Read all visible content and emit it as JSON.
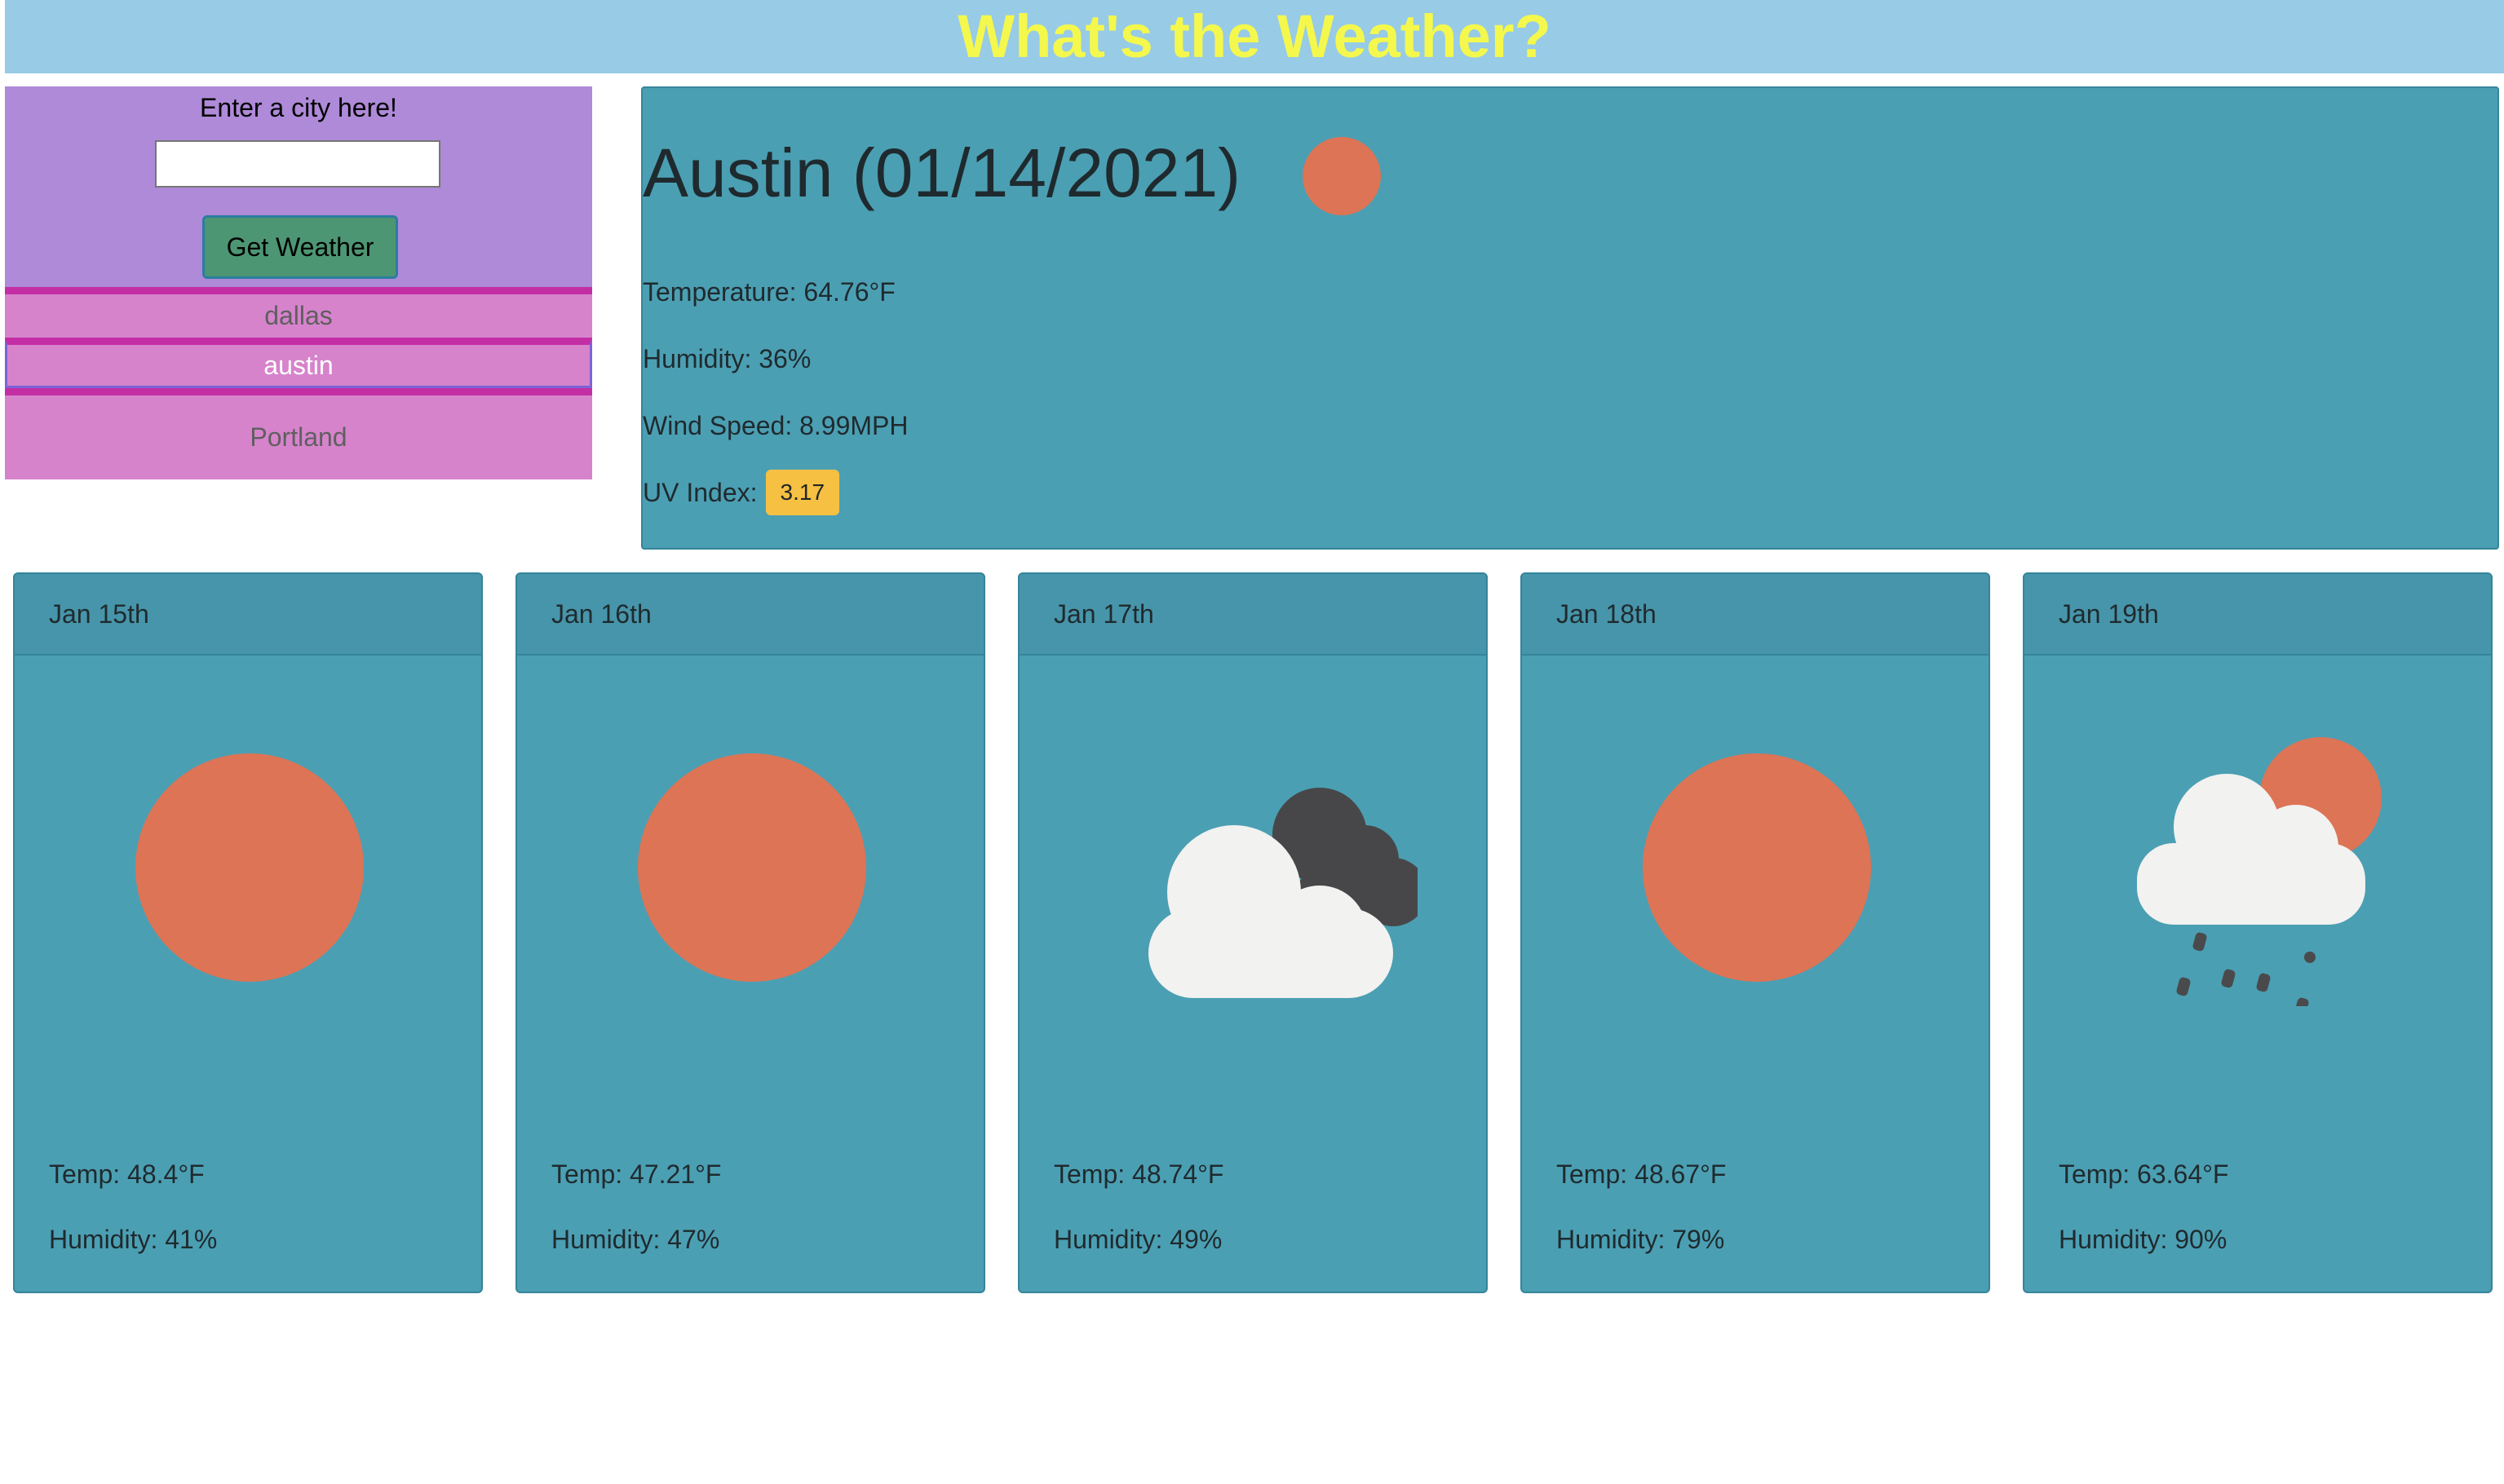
{
  "header": {
    "title": "What's the Weather?"
  },
  "search": {
    "prompt": "Enter a city here!",
    "input_value": "",
    "button_label": "Get Weather"
  },
  "history": {
    "items": [
      {
        "label": "dallas",
        "active": false
      },
      {
        "label": "austin",
        "active": true
      },
      {
        "label": "Portland",
        "active": false
      }
    ]
  },
  "current": {
    "title": "Austin (01/14/2021)",
    "icon": "sun-icon",
    "temperature": "Temperature: 64.76°F",
    "humidity": "Humidity: 36%",
    "wind": "Wind Speed: 8.99MPH",
    "uv_label": "UV Index:",
    "uv_value": "3.17",
    "uv_color": "#f6c042"
  },
  "forecast": [
    {
      "date": "Jan 15th",
      "icon": "sun-icon",
      "temp": "Temp: 48.4°F",
      "humidity": "Humidity: 41%"
    },
    {
      "date": "Jan 16th",
      "icon": "sun-icon",
      "temp": "Temp: 47.21°F",
      "humidity": "Humidity: 47%"
    },
    {
      "date": "Jan 17th",
      "icon": "clouds-icon",
      "temp": "Temp: 48.74°F",
      "humidity": "Humidity: 49%"
    },
    {
      "date": "Jan 18th",
      "icon": "sun-icon",
      "temp": "Temp: 48.67°F",
      "humidity": "Humidity: 79%"
    },
    {
      "date": "Jan 19th",
      "icon": "rain-sun-icon",
      "temp": "Temp: 63.64°F",
      "humidity": "Humidity: 90%"
    }
  ],
  "colors": {
    "header_bg": "#97cbe6",
    "title_color": "#f4f84d",
    "sidebar_bg": "#ae8ad8",
    "history_bg": "#d683cc",
    "panel_bg": "#4b9fb3",
    "button_bg": "#4d9673",
    "sun": "#dd7455"
  }
}
